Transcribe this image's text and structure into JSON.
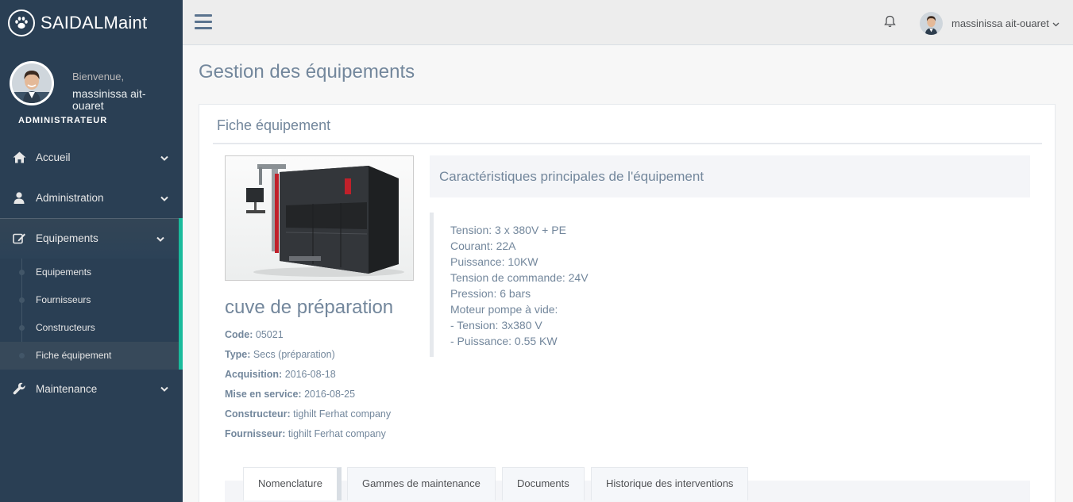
{
  "app": {
    "brand": "SAIDALMaint"
  },
  "profile": {
    "welcome": "Bienvenue,",
    "name": "massinissa ait-ouaret",
    "role": "ADMINISTRATEUR"
  },
  "sidebar": {
    "items": [
      {
        "label": "Accueil",
        "icon": "home-icon"
      },
      {
        "label": "Administration",
        "icon": "user-icon"
      },
      {
        "label": "Equipements",
        "icon": "edit-icon"
      },
      {
        "label": "Maintenance",
        "icon": "wrench-icon"
      }
    ],
    "submenu": [
      {
        "label": "Equipements"
      },
      {
        "label": "Fournisseurs"
      },
      {
        "label": "Constructeurs"
      },
      {
        "label": "Fiche équipement"
      }
    ]
  },
  "topnav": {
    "user_name": "massinissa ait-ouaret"
  },
  "page": {
    "title": "Gestion des équipements"
  },
  "panel": {
    "title": "Fiche équipement"
  },
  "equipment": {
    "name": "cuve de préparation",
    "fields": [
      {
        "label": "Code:",
        "value": "05021"
      },
      {
        "label": "Type:",
        "value": "Secs (préparation)"
      },
      {
        "label": "Acquisition:",
        "value": "2016-08-18"
      },
      {
        "label": "Mise en service:",
        "value": "2016-08-25"
      },
      {
        "label": "Constructeur:",
        "value": "tighilt Ferhat company"
      },
      {
        "label": "Fournisseur:",
        "value": "tighilt Ferhat company"
      }
    ]
  },
  "characteristics": {
    "title": "Caractéristiques principales de l'équipement",
    "lines": [
      "Tension: 3 x 380V + PE",
      "Courant: 22A",
      "Puissance: 10KW",
      "Tension de commande: 24V",
      "Pression: 6 bars",
      "Moteur pompe à vide:",
      "- Tension: 3x380 V",
      "- Puissance: 0.55 KW"
    ]
  },
  "tabs": [
    {
      "label": "Nomenclature"
    },
    {
      "label": "Gammes de maintenance"
    },
    {
      "label": "Documents"
    },
    {
      "label": "Historique des interventions"
    }
  ]
}
